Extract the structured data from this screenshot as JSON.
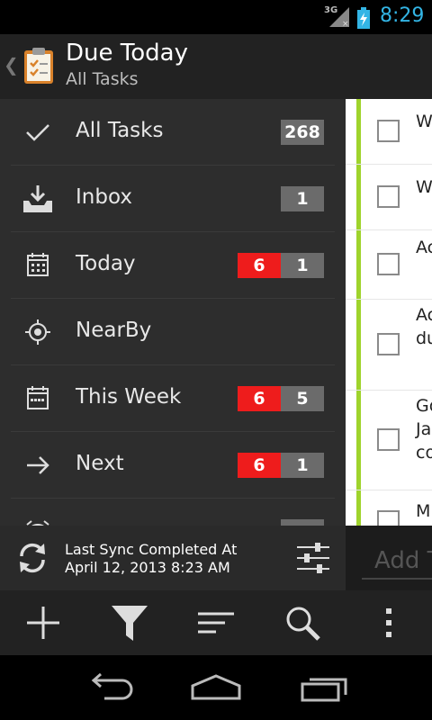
{
  "status_bar": {
    "network": "3G",
    "time": "8:29"
  },
  "action_bar": {
    "title": "Due Today",
    "subtitle": "All Tasks"
  },
  "drawer": {
    "items": [
      {
        "label": "All Tasks",
        "icon": "checkmark-icon",
        "red_count": "",
        "gray_count": "268"
      },
      {
        "label": "Inbox",
        "icon": "inbox-icon",
        "red_count": "",
        "gray_count": "1"
      },
      {
        "label": "Today",
        "icon": "calendar-day-icon",
        "red_count": "6",
        "gray_count": "1"
      },
      {
        "label": "NearBy",
        "icon": "location-target-icon",
        "red_count": "",
        "gray_count": ""
      },
      {
        "label": "This Week",
        "icon": "calendar-week-icon",
        "red_count": "6",
        "gray_count": "5"
      },
      {
        "label": "Next",
        "icon": "arrow-right-icon",
        "red_count": "6",
        "gray_count": "1"
      }
    ]
  },
  "task_list": {
    "rows": [
      {
        "lines": [
          "W"
        ]
      },
      {
        "lines": [
          "W"
        ]
      },
      {
        "lines": [
          "Ac"
        ]
      },
      {
        "lines": [
          "Ac",
          "du"
        ]
      },
      {
        "lines": [
          "Go",
          "Ja",
          "co"
        ]
      },
      {
        "lines": [
          "M"
        ]
      }
    ]
  },
  "sync": {
    "line1": "Last Sync Completed At",
    "line2": "April 12, 2013 8:23 AM"
  },
  "add_task": {
    "placeholder": "Add T"
  },
  "toolbar": {
    "buttons": [
      "add-icon",
      "filter-icon",
      "sort-icon",
      "search-icon",
      "overflow-menu-icon"
    ]
  },
  "colors": {
    "accent_blue": "#33b5e5",
    "count_red": "#ee1c1c",
    "count_gray": "#6b6b6b",
    "priority_green": "#9fd32c"
  }
}
